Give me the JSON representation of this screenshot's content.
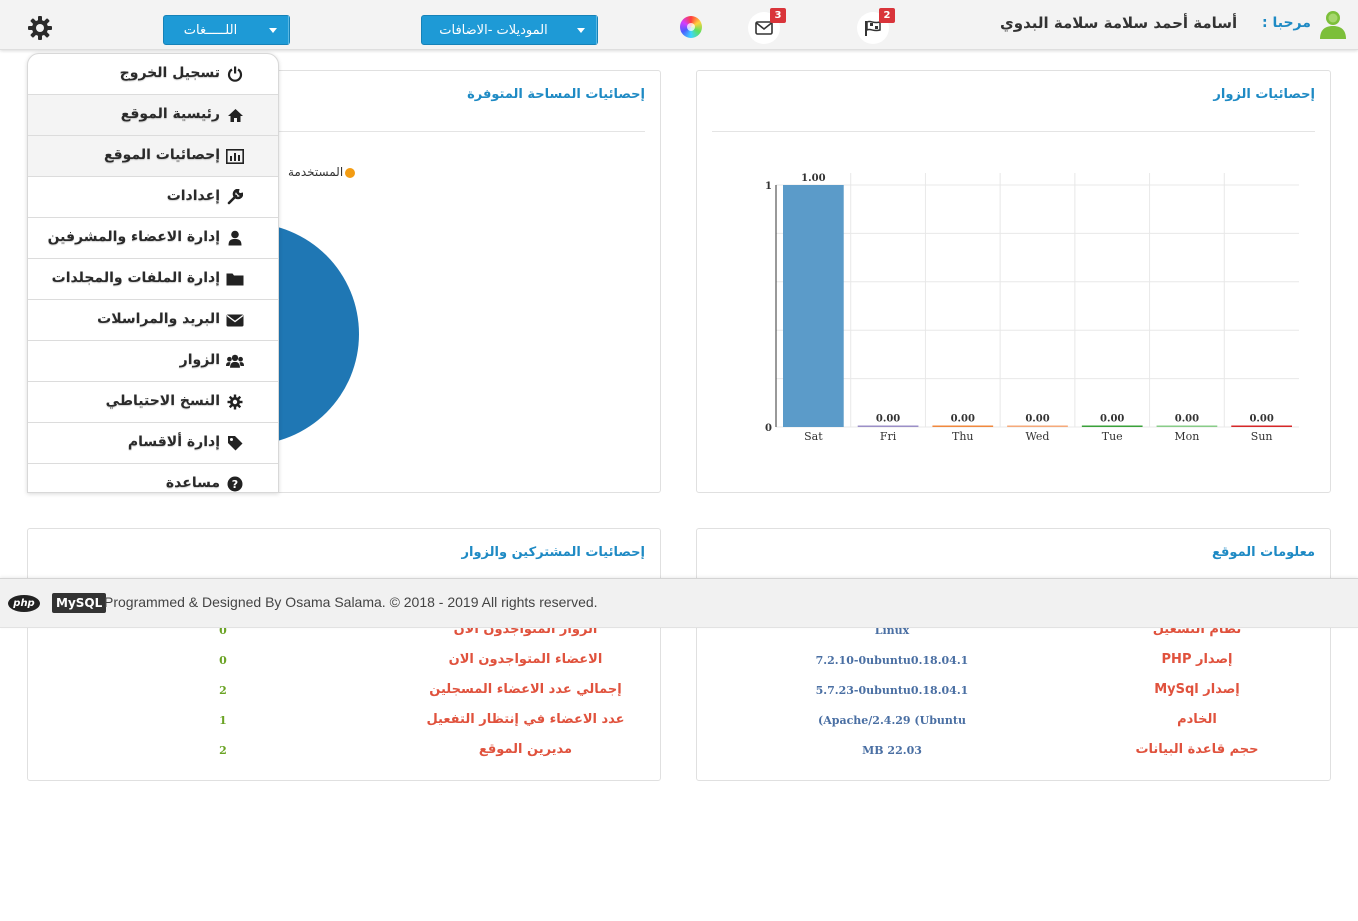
{
  "header": {
    "welcome_label": "مرحبا :",
    "user_name": "أسامة أحمد سلامة سلامة البدوي",
    "languages_label": "اللـــــغات",
    "modules_label": "الموديلات -الاضافات",
    "mail_count": "3",
    "flag_count": "2",
    "icons": [
      "gear-icon",
      "color-wheel-icon",
      "envelope-icon",
      "flag-icon",
      "user-avatar-icon"
    ]
  },
  "side_menu": {
    "items": [
      {
        "label": "تسجيل الخروج",
        "icon": "power-icon"
      },
      {
        "label": "رئيسية الموقع",
        "icon": "home-icon"
      },
      {
        "label": "إحصائيات الموقع",
        "icon": "bar-chart-icon"
      },
      {
        "label": "إعدادات",
        "icon": "wrench-icon"
      },
      {
        "label": "إدارة الاعضاء والمشرفين",
        "icon": "user-icon"
      },
      {
        "label": "إدارة الملفات والمجلدات",
        "icon": "folder-icon"
      },
      {
        "label": "البريد والمراسلات",
        "icon": "envelope-icon"
      },
      {
        "label": "الزوار",
        "icon": "users-icon"
      },
      {
        "label": "النسخ الاحتياطي",
        "icon": "cog-icon"
      },
      {
        "label": "إدارة ألاقسام",
        "icon": "tag-icon"
      },
      {
        "label": "مساعدة",
        "icon": "question-icon"
      }
    ]
  },
  "visitors_panel": {
    "title": "إحصائيات الزوار"
  },
  "space_panel": {
    "title": "إحصائيات المساحة المتوفرة",
    "legend_label": "المستخدمة"
  },
  "site_info_panel": {
    "title": "معلومات الموقع",
    "rows": [
      {
        "label": "نظام التشغيل",
        "value": "Linux"
      },
      {
        "label": "إصدار PHP",
        "value": "7.2.10-0ubuntu0.18.04.1"
      },
      {
        "label": "إصدار MySql",
        "value": "5.7.23-0ubuntu0.18.04.1"
      },
      {
        "label": "الخادم",
        "value": "(Apache/2.4.29 (Ubuntu"
      },
      {
        "label": "حجم قاعدة البيانات",
        "value": "MB 22.03"
      }
    ]
  },
  "subscribers_panel": {
    "title": "إحصائيات المشتركين والزوار",
    "rows": [
      {
        "label": "الزوار المتواجدون الان",
        "value": "0"
      },
      {
        "label": "الاعضاء المتواجدون الان",
        "value": "0"
      },
      {
        "label": "إجمالي عدد الاعضاء المسجلين",
        "value": "2"
      },
      {
        "label": "عدد الاعضاء في إنتظار التفعيل",
        "value": "1"
      },
      {
        "label": "مديرين الموقع",
        "value": "2"
      }
    ]
  },
  "footer": {
    "php_logo": "php",
    "mysql_logo": "MySQL",
    "text": "Programmed & Designed By Osama Salama. © 2018 - 2019 All rights reserved."
  },
  "colors": {
    "accent": "#1e9ad6",
    "title_blue": "#1e8ac4",
    "label_red": "#e0523d",
    "value_blue": "#4a6fa3",
    "value_green": "#6aa324",
    "pie_blue": "#1f77b4",
    "legend_orange": "#f39c12"
  },
  "chart_data": [
    {
      "type": "bar",
      "categories": [
        "Sat",
        "Fri",
        "Thu",
        "Wed",
        "Tue",
        "Mon",
        "Sun"
      ],
      "values": [
        1.0,
        0.0,
        0.0,
        0.0,
        0.0,
        0.0,
        0.0
      ],
      "data_labels": [
        "1.00",
        "0.00",
        "0.00",
        "0.00",
        "0.00",
        "0.00",
        "0.00"
      ],
      "bar_colors": [
        "#5b9bc9",
        "#9b8fc7",
        "#f0883e",
        "#f5a97a",
        "#3aa13a",
        "#88cc88",
        "#d62728"
      ],
      "ylim": [
        0,
        1
      ],
      "y_ticks": [
        "0",
        "1"
      ],
      "grid": true
    },
    {
      "type": "pie",
      "labels": [
        "المستخدمة"
      ],
      "values": [
        100
      ],
      "colors": [
        "#1f77b4"
      ]
    }
  ]
}
